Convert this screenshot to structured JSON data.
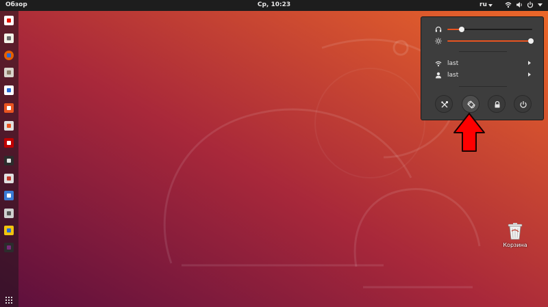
{
  "topbar": {
    "activities_label": "Обзор",
    "clock": "Ср, 10:23",
    "language": "ru"
  },
  "dock": {
    "items": [
      {
        "name": "yandex-browser-icon",
        "color": "#ffffff",
        "accent": "#e61400"
      },
      {
        "name": "text-editor-icon",
        "color": "#f3f3e8",
        "accent": "#6c6c6c"
      },
      {
        "name": "firefox-icon",
        "color": "#e66000",
        "accent": "#2a6bd6"
      },
      {
        "name": "file-manager-icon",
        "color": "#d9d4cc",
        "accent": "#8a7a66"
      },
      {
        "name": "libreoffice-writer-icon",
        "color": "#ffffff",
        "accent": "#2a6bd6"
      },
      {
        "name": "software-center-icon",
        "color": "#e95420",
        "accent": "#ffffff"
      },
      {
        "name": "settings-icon",
        "color": "#e0e0e0",
        "accent": "#e95420"
      },
      {
        "name": "filezilla-icon",
        "color": "#bf0000",
        "accent": "#ffffff"
      },
      {
        "name": "terminal-icon",
        "color": "#2c2c2c",
        "accent": "#e0e0e0"
      },
      {
        "name": "disk-usage-icon",
        "color": "#e0e0e0",
        "accent": "#c0392b"
      },
      {
        "name": "system-monitor-icon",
        "color": "#3a7bd5",
        "accent": "#ffffff"
      },
      {
        "name": "calculator-icon",
        "color": "#d0d0d0",
        "accent": "#555555"
      },
      {
        "name": "mail-app-icon",
        "color": "#f1c40f",
        "accent": "#2a6bd6"
      },
      {
        "name": "misc-app-icon",
        "color": "#2c2c2c",
        "accent": "#7a2a7a"
      }
    ],
    "apps_grid_icon": "apps-grid-icon"
  },
  "desktop": {
    "trash_label": "Корзина",
    "trash_icon": "trash-icon"
  },
  "system_menu": {
    "volume": {
      "icon": "headphones-icon",
      "level": 0.17
    },
    "brightness": {
      "icon": "brightness-icon",
      "level": 0.98
    },
    "rows": [
      {
        "icon": "wifi-icon",
        "label": "last"
      },
      {
        "icon": "user-icon",
        "label": "last"
      }
    ],
    "buttons": [
      {
        "icon": "settings-tools-icon"
      },
      {
        "icon": "rotation-lock-icon"
      },
      {
        "icon": "lock-icon"
      },
      {
        "icon": "power-icon"
      }
    ]
  },
  "colors": {
    "accent": "#e95420",
    "highlight_arrow": "#ff0000"
  }
}
